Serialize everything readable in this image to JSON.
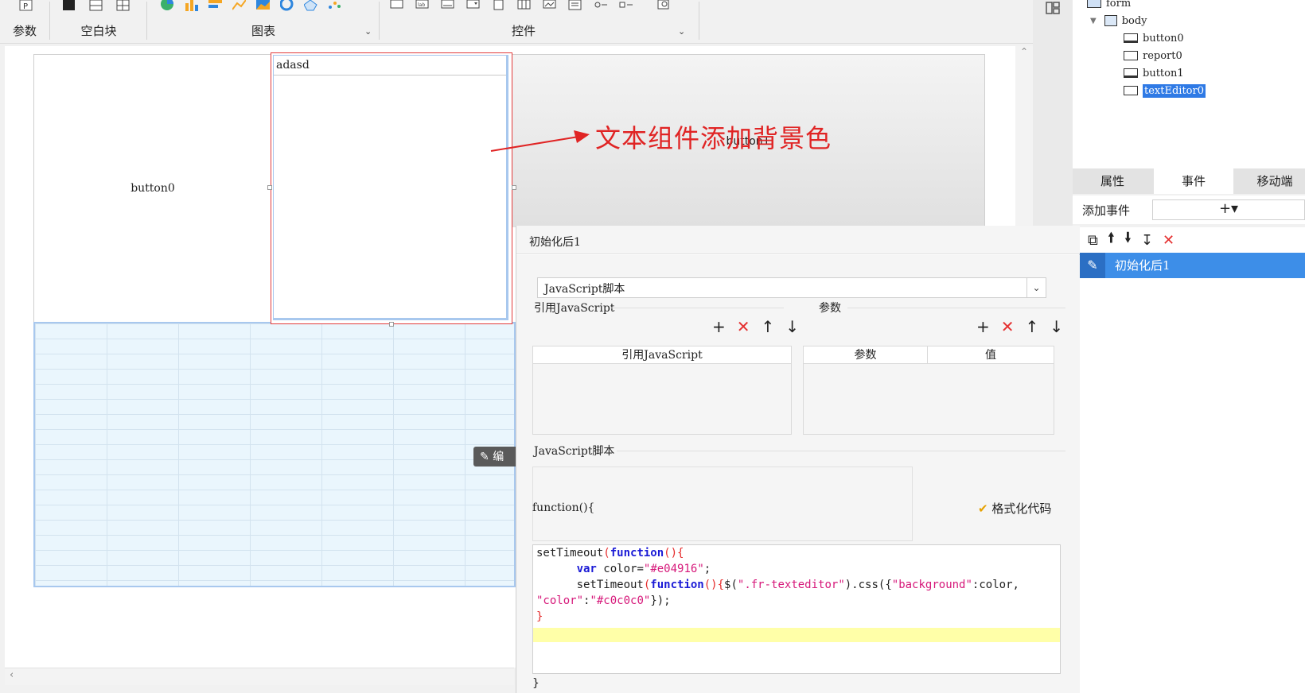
{
  "ribbon": {
    "groups": [
      {
        "label": "参数"
      },
      {
        "label": "空白块"
      },
      {
        "label": "图表"
      },
      {
        "label": "控件"
      }
    ]
  },
  "canvas": {
    "button0_label": "button0",
    "texteditor_title": "adasd",
    "button1_label": "button1",
    "edit_badge": "编"
  },
  "annotation": {
    "text": "文本组件添加背景色"
  },
  "tree": {
    "items": [
      {
        "label": "form"
      },
      {
        "label": "body"
      },
      {
        "label": "button0"
      },
      {
        "label": "report0"
      },
      {
        "label": "button1"
      },
      {
        "label": "textEditor0"
      }
    ]
  },
  "props": {
    "tabs": [
      {
        "label": "属性"
      },
      {
        "label": "事件"
      },
      {
        "label": "移动端"
      }
    ],
    "add_event_label": "添加事件",
    "add_event_value": "+▾"
  },
  "events": {
    "items": [
      {
        "label": "初始化后1"
      }
    ]
  },
  "dialog": {
    "title": "初始化后1",
    "type_value": "JavaScript脚本",
    "ref_js_label": "引用JavaScript",
    "params_label": "参数",
    "ref_js_column": "引用JavaScript",
    "param_column": "参数",
    "value_column": "值",
    "script_label": "JavaScript脚本",
    "function_sig": "function(){",
    "format_button": "格式化代码",
    "closing": "}"
  },
  "colors": {
    "accent": "#2f7ae5",
    "annotation": "#e02424",
    "selection_border": "#e23b3b"
  }
}
